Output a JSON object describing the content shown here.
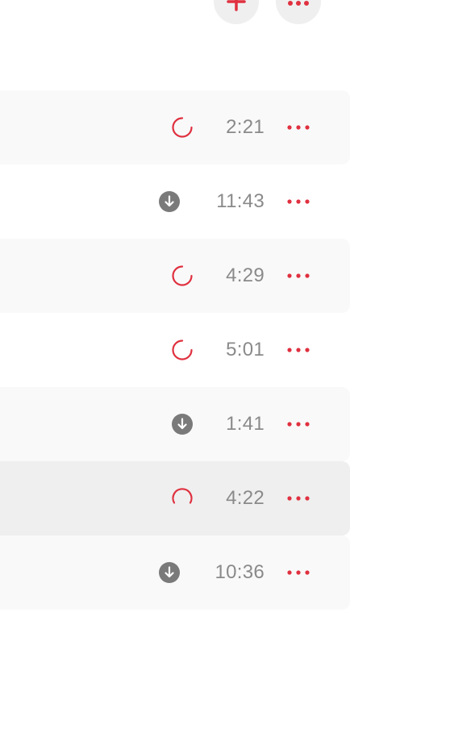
{
  "toolbar": {
    "add_icon": "plus-icon",
    "more_icon": "ellipsis-icon",
    "accent_color": "#e0303f"
  },
  "tracks": [
    {
      "status": "loading",
      "duration": "2:21"
    },
    {
      "status": "downloaded",
      "duration": "11:43"
    },
    {
      "status": "loading",
      "duration": "4:29"
    },
    {
      "status": "loading",
      "duration": "5:01"
    },
    {
      "status": "downloaded",
      "duration": "1:41"
    },
    {
      "status": "loading",
      "duration": "4:22"
    },
    {
      "status": "downloaded",
      "duration": "10:36"
    }
  ]
}
